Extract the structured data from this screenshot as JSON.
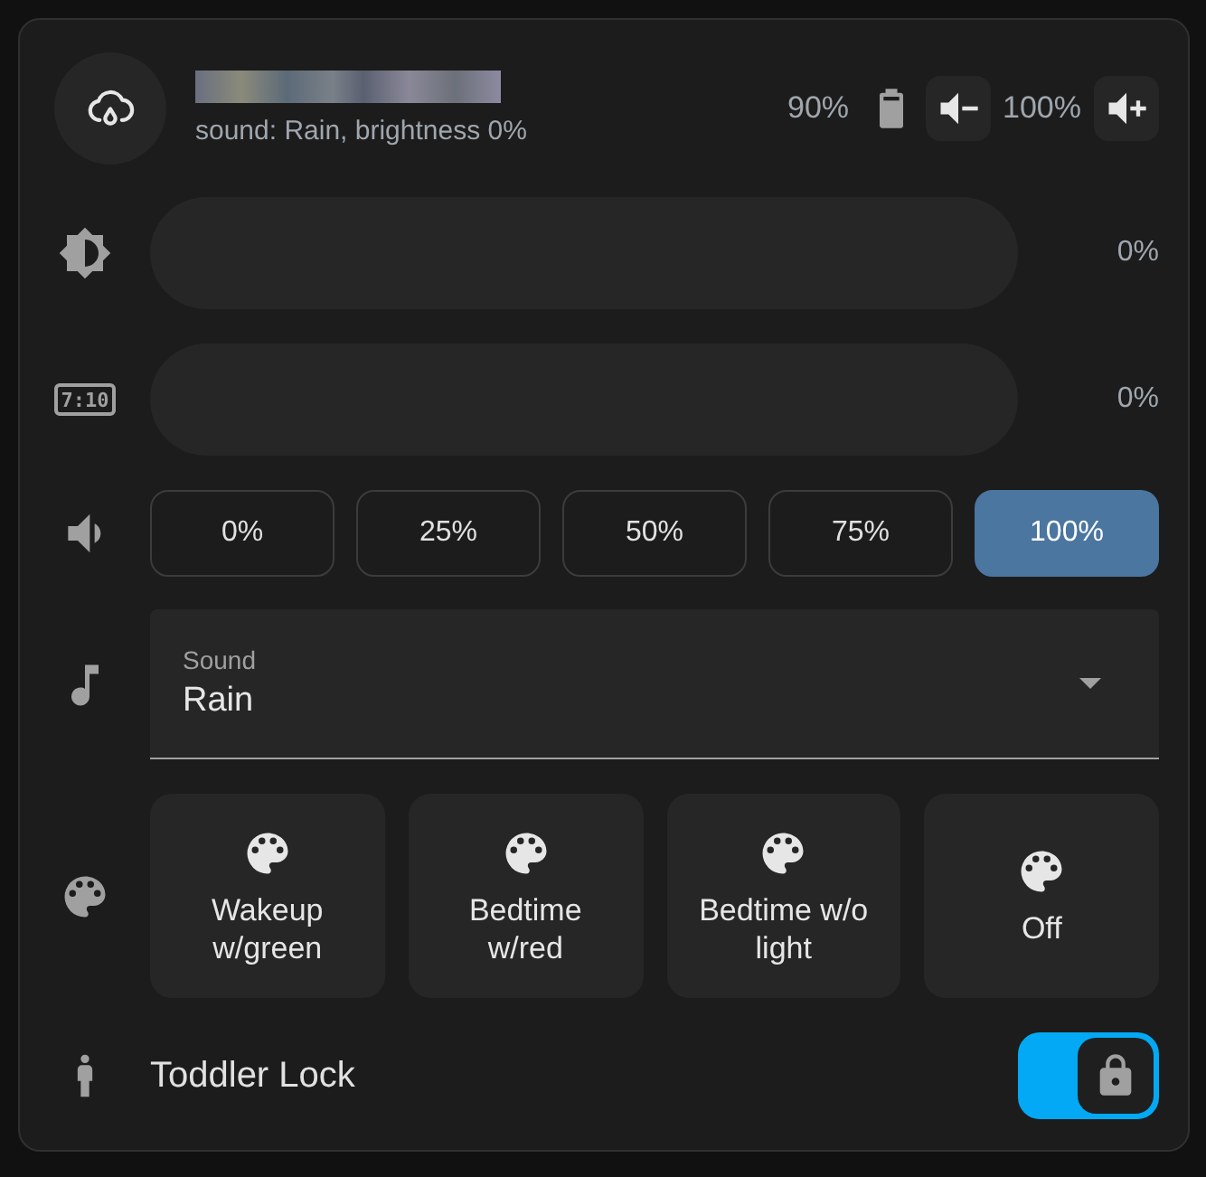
{
  "header": {
    "subtitle": "sound: Rain, brightness 0%",
    "battery": "90%",
    "volume": "100%"
  },
  "sliders": [
    {
      "kind": "brightness",
      "level": 0,
      "reading": "0%"
    },
    {
      "kind": "clock",
      "icon_text": "7:10",
      "level": 0,
      "reading": "0%"
    }
  ],
  "volume_options": [
    {
      "label": "0%",
      "selected": false
    },
    {
      "label": "25%",
      "selected": false
    },
    {
      "label": "50%",
      "selected": false
    },
    {
      "label": "75%",
      "selected": false
    },
    {
      "label": "100%",
      "selected": true
    }
  ],
  "sound_select": {
    "label": "Sound",
    "value": "Rain"
  },
  "scenes": [
    {
      "label": "Wakeup w/green"
    },
    {
      "label": "Bedtime w/red"
    },
    {
      "label": "Bedtime w/o light"
    },
    {
      "label": "Off"
    }
  ],
  "toddler_lock": {
    "label": "Toddler Lock",
    "on": true
  }
}
